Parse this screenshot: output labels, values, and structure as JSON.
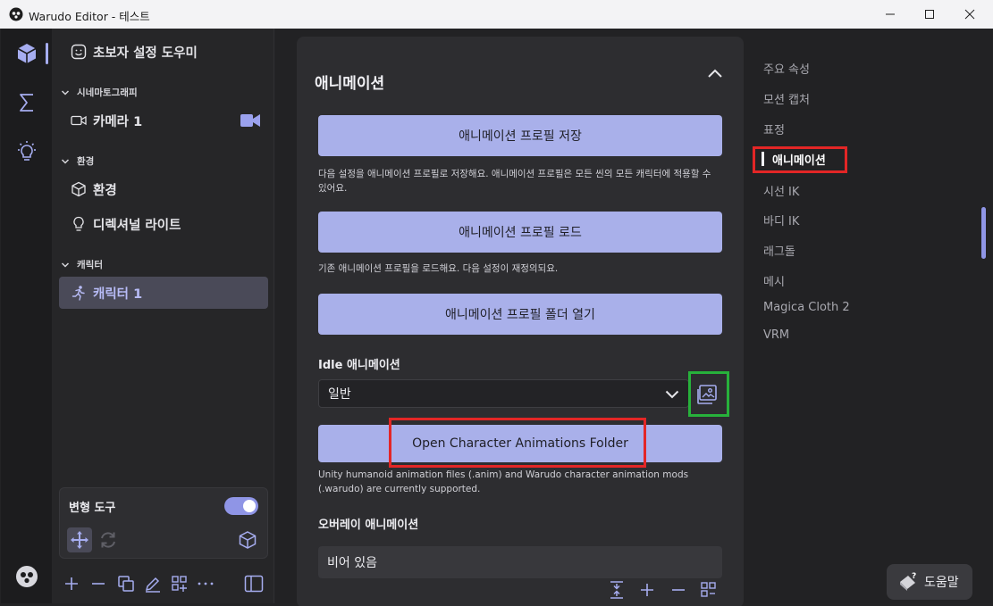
{
  "window": {
    "title": "Warudo Editor - 테스트"
  },
  "tree": {
    "beginner_helper": "초보자 설정 도우미",
    "sections": [
      {
        "label": "시네마토그래피",
        "items": [
          "카메라 1"
        ]
      },
      {
        "label": "환경",
        "items": [
          "환경",
          "디렉셔널 라이트"
        ]
      },
      {
        "label": "캐릭터",
        "items": [
          "캐릭터 1"
        ]
      }
    ],
    "transform_tool": {
      "label": "변형 도구",
      "enabled": true
    }
  },
  "main": {
    "section_title": "애니메이션",
    "save_profile_button": "애니메이션 프로필 저장",
    "save_profile_desc": "다음 설정을 애니메이션 프로필로 저장해요. 애니메이션 프로필은 모든 씬의 모든 캐릭터에 적용할 수 있어요.",
    "load_profile_button": "애니메이션 프로필 로드",
    "load_profile_desc": "기존 애니메이션 프로필을 로드해요. 다음 설정이 재정의되요.",
    "open_profile_folder_button": "애니메이션 프로필 폴더 열기",
    "idle_label": "Idle 애니메이션",
    "idle_value": "일반",
    "open_anim_folder_button": "Open Character Animations Folder",
    "open_anim_folder_desc": "Unity humanoid animation files (.anim) and Warudo character animation mods (.warudo) are currently supported.",
    "overlay_label": "오버레이 애니메이션",
    "overlay_value": "비어 있음"
  },
  "nav": {
    "items": [
      "주요 속성",
      "모션 캡처",
      "표정",
      "애니메이션",
      "시선 IK",
      "바디 IK",
      "래그돌",
      "메시",
      "Magica Cloth 2",
      "VRM"
    ],
    "active_index": 3
  },
  "help": {
    "label": "도움말"
  },
  "colors": {
    "accent": "#a9b0ea",
    "highlight_red": "#e32626",
    "highlight_green": "#27b13b"
  }
}
